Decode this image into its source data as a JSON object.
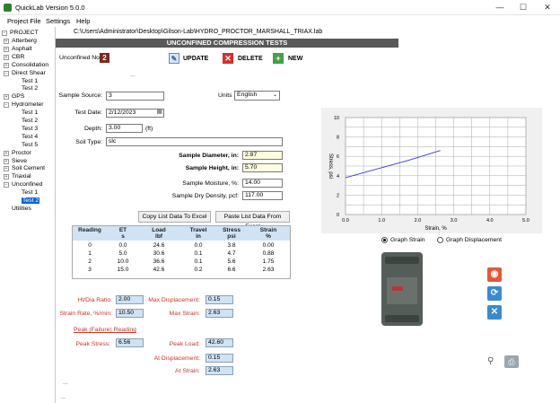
{
  "window": {
    "title": "QuickLab  Version 5.0.0",
    "minimize": "—",
    "maximize": "☐",
    "close": "✕"
  },
  "menu": [
    "Project File",
    "Settings",
    "Help"
  ],
  "path": "C:\\Users\\Administrator\\Desktop\\Gilson-Lab\\HYDRO_PROCTOR_MARSHALL_TRIAX.lab",
  "tree": {
    "root": "PROJECT",
    "items": [
      {
        "label": "Atterberg",
        "expander": "+"
      },
      {
        "label": "Asphalt",
        "expander": "+"
      },
      {
        "label": "CBR",
        "expander": "+"
      },
      {
        "label": "Consolidation",
        "expander": "+"
      },
      {
        "label": "Direct Shear",
        "expander": "−"
      },
      {
        "label": "Test 1",
        "child": true
      },
      {
        "label": "Test 2",
        "child": true
      },
      {
        "label": "GPS",
        "expander": "+"
      },
      {
        "label": "Hydrometer",
        "expander": "−"
      },
      {
        "label": "Test 1",
        "child": true
      },
      {
        "label": "Test 2",
        "child": true
      },
      {
        "label": "Test 3",
        "child": true
      },
      {
        "label": "Test 4",
        "child": true
      },
      {
        "label": "Test 5",
        "child": true
      },
      {
        "label": "Proctor",
        "expander": "+"
      },
      {
        "label": "Sieve",
        "expander": "+"
      },
      {
        "label": "Soil Cement",
        "expander": "+"
      },
      {
        "label": "Triaxial",
        "expander": "+"
      },
      {
        "label": "Unconfined",
        "expander": "−"
      },
      {
        "label": "Test 1",
        "child": true
      },
      {
        "label": "Test 2",
        "child": true,
        "selected": true
      },
      {
        "label": "Utilities"
      }
    ]
  },
  "header": "UNCONFINED COMPRESSION TESTS",
  "test": {
    "label": "Unconfined No.",
    "number": "2"
  },
  "toolbar": {
    "update": "UPDATE",
    "delete": "DELETE",
    "new": "NEW"
  },
  "ellipsis": "...",
  "form": {
    "sample_source_label": "Sample Source:",
    "sample_source": "3",
    "units_label": "Units",
    "units": "English",
    "test_date_label": "Test Date:",
    "test_date": "2/12/2023",
    "depth_label": "Depth:",
    "depth": "3.00",
    "depth_unit": "(ft)",
    "soil_type_label": "Soil Type:",
    "soil_type": "slc",
    "diameter_label": "Sample Diameter, in:",
    "diameter": "2.87",
    "height_label": "Sample Height, in:",
    "height": "5.70",
    "moisture_label": "Sample Moisture, %:",
    "moisture": "14.00",
    "dry_density_label": "Sample Dry Density, pcf:",
    "dry_density": "117.00"
  },
  "buttons": {
    "copy": "Copy List Data To Excel",
    "paste": "Paste List Data From Excel"
  },
  "table": {
    "headers": [
      {
        "l1": "Reading",
        "l2": ""
      },
      {
        "l1": "ET",
        "l2": "s"
      },
      {
        "l1": "Load",
        "l2": "lbf"
      },
      {
        "l1": "Travel",
        "l2": "in"
      },
      {
        "l1": "Stress",
        "l2": "psi"
      },
      {
        "l1": "Strain",
        "l2": "%"
      }
    ],
    "rows": [
      [
        "0",
        "0.0",
        "24.6",
        "0.0",
        "3.8",
        "0.00"
      ],
      [
        "1",
        "5.0",
        "30.6",
        "0.1",
        "4.7",
        "0.88"
      ],
      [
        "2",
        "10.0",
        "36.6",
        "0.1",
        "5.6",
        "1.75"
      ],
      [
        "3",
        "15.0",
        "42.6",
        "0.2",
        "6.6",
        "2.63"
      ]
    ]
  },
  "results": {
    "ht_dia_label": "Ht/Dia Ratio:",
    "ht_dia": "2.00",
    "max_disp_label": "Max Displacement:",
    "max_disp": "0.15",
    "strain_rate_label": "Strain Rate, %/min:",
    "strain_rate": "10.50",
    "max_strain_label": "Max Strain:",
    "max_strain": "2.63",
    "peak_link": "Peak (Failure) Reading",
    "peak_stress_label": "Peak Stress:",
    "peak_stress": "6.56",
    "peak_load_label": "Peak Load:",
    "peak_load": "42.60",
    "at_disp_label": "At Displacement:",
    "at_disp": "0.15",
    "at_strain_label": "At Strain:",
    "at_strain": "2.63"
  },
  "graph_options": {
    "strain": "Graph Strain",
    "displacement": "Graph Displacement"
  },
  "chart_data": {
    "type": "line",
    "xlabel": "Strain, %",
    "ylabel": "Stress, psi",
    "xlim": [
      0,
      5
    ],
    "ylim": [
      0,
      10
    ],
    "xticks": [
      "0.0",
      "1.0",
      "2.0",
      "3.0",
      "4.0",
      "5.0"
    ],
    "yticks": [
      "0",
      "2",
      "4",
      "6",
      "8",
      "10"
    ],
    "grid": true,
    "series": [
      {
        "x": [
          0,
          0.88,
          1.75,
          2.63
        ],
        "y": [
          3.8,
          4.7,
          5.6,
          6.6
        ],
        "color": "#3a3ad0"
      }
    ]
  },
  "footer_dots": [
    "...",
    "..."
  ]
}
